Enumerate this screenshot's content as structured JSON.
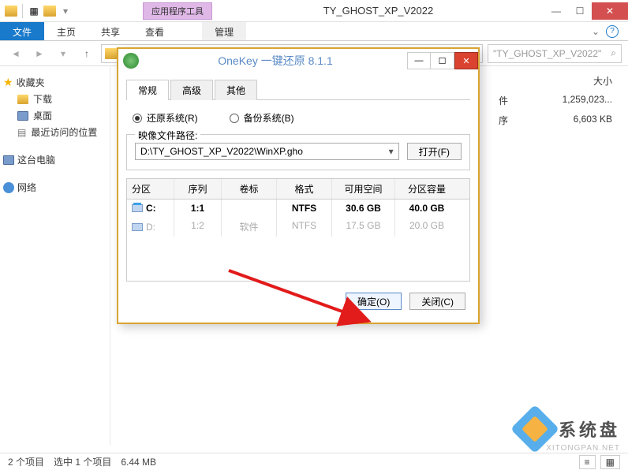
{
  "window": {
    "tool_tab": "应用程序工具",
    "title": "TY_GHOST_XP_V2022"
  },
  "ribbon": {
    "file": "文件",
    "home": "主页",
    "share": "共享",
    "view": "查看",
    "manage": "管理"
  },
  "breadcrumb": {
    "search_placeholder": "\"TY_GHOST_XP_V2022\""
  },
  "sidebar": {
    "favorites": "收藏夹",
    "downloads": "下载",
    "desktop": "桌面",
    "recent": "最近访问的位置",
    "thispc": "这台电脑",
    "network": "网络"
  },
  "columns": {
    "size": "大小",
    "type_suffix1": "件",
    "type_suffix2": "序"
  },
  "files": {
    "row1_size": "1,259,023...",
    "row2_size": "6,603 KB"
  },
  "status": {
    "items": "2 个项目",
    "selected": "选中 1 个项目",
    "size": "6.44 MB"
  },
  "watermark": {
    "text": "系统盘",
    "url": "XITONGPAN.NET"
  },
  "dialog": {
    "title": "OneKey 一键还原 8.1.1",
    "tabs": {
      "general": "常规",
      "advanced": "高级",
      "other": "其他"
    },
    "radio_restore": "还原系统(R)",
    "radio_backup": "备份系统(B)",
    "fieldset_legend": "映像文件路径:",
    "path_value": "D:\\TY_GHOST_XP_V2022\\WinXP.gho",
    "open_button": "打开(F)",
    "grid": {
      "headers": {
        "part": "分区",
        "seq": "序列",
        "vol": "卷标",
        "fmt": "格式",
        "free": "可用空间",
        "cap": "分区容量"
      },
      "rows": [
        {
          "part": "C:",
          "seq": "1:1",
          "vol": "",
          "fmt": "NTFS",
          "free": "30.6 GB",
          "cap": "40.0 GB",
          "selected": true,
          "win": true
        },
        {
          "part": "D:",
          "seq": "1:2",
          "vol": "软件",
          "fmt": "NTFS",
          "free": "17.5 GB",
          "cap": "20.0 GB",
          "selected": false,
          "win": false
        }
      ]
    },
    "ok": "确定(O)",
    "cancel": "关闭(C)"
  }
}
